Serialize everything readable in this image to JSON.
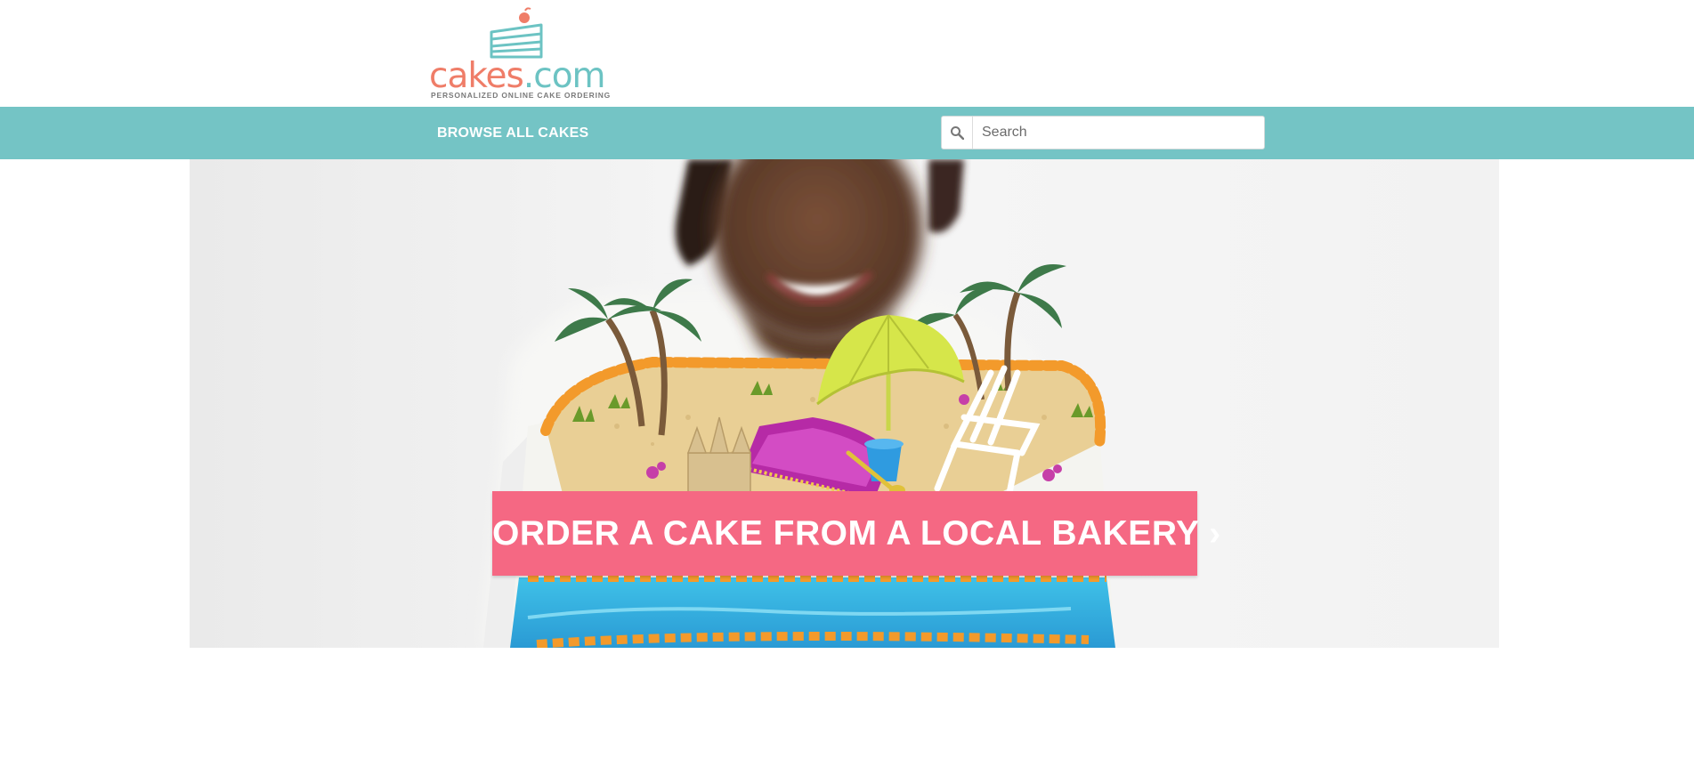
{
  "logo": {
    "brand_part1": "cakes",
    "brand_part2": ".com",
    "tagline": "PERSONALIZED ONLINE CAKE ORDERING"
  },
  "nav": {
    "browse_label": "BROWSE ALL CAKES"
  },
  "search": {
    "placeholder": "Search",
    "icon": "magnifier-icon"
  },
  "hero": {
    "cta_label": "ORDER A CAKE FROM A LOCAL BAKERY ›"
  },
  "colors": {
    "brand_coral": "#ef7d68",
    "brand_teal": "#6cc3c3",
    "nav_bg": "#74c4c5",
    "cta_pink": "#f56883"
  }
}
